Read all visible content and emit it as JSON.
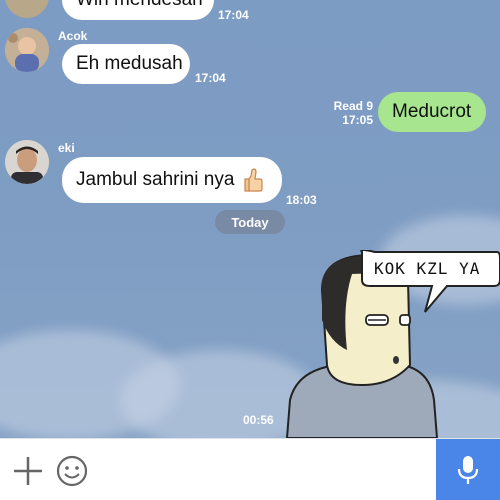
{
  "messages": [
    {
      "sender": "",
      "text": "Win mendesah",
      "time": "17:04"
    },
    {
      "sender": "Acok",
      "text": "Eh medusah",
      "time": "17:04"
    },
    {
      "sender": "me",
      "text": "Meducrot",
      "read": "Read 9",
      "time": "17:05"
    },
    {
      "sender": "eki",
      "text": "Jambul sahrini nya",
      "time": "18:03",
      "emoji": "thumbs-up-icon"
    }
  ],
  "date_separator": "Today",
  "sticker": {
    "speech": "KOK KZL YA",
    "time": "00:56"
  },
  "input": {
    "placeholder": ""
  },
  "colors": {
    "chat_bg": "#7d9cc3",
    "own_bubble": "#a7e58f",
    "mic_button": "#4a86e8"
  }
}
